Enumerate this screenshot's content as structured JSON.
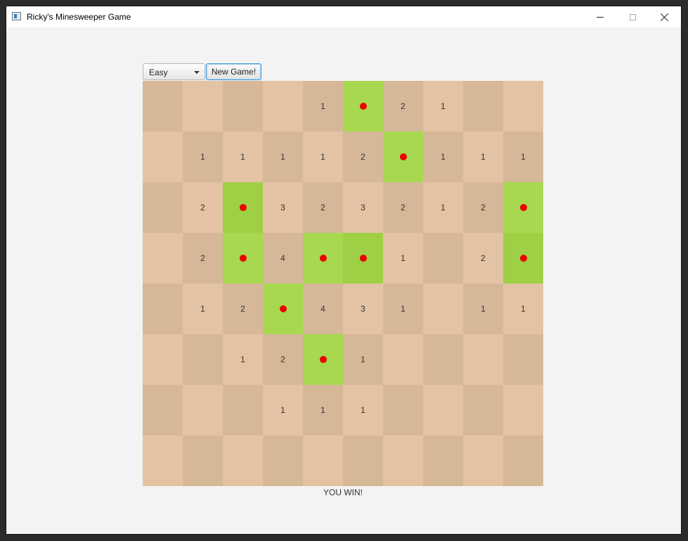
{
  "window": {
    "title": "Ricky's Minesweeper Game"
  },
  "toolbar": {
    "difficulty_selected": "Easy",
    "new_game_label": "New Game!"
  },
  "board": {
    "rows": 8,
    "cols": 10,
    "cells": [
      [
        "",
        "",
        "",
        "",
        "1",
        "*",
        "2",
        "1",
        "",
        ""
      ],
      [
        "",
        "1",
        "1",
        "1",
        "1",
        "2",
        "*",
        "1",
        "1",
        "1"
      ],
      [
        "",
        "2",
        "*",
        "3",
        "2",
        "3",
        "2",
        "1",
        "2",
        "*"
      ],
      [
        "",
        "2",
        "*",
        "4",
        "*",
        "*",
        "1",
        "",
        "2",
        "*"
      ],
      [
        "",
        "1",
        "2",
        "*",
        "4",
        "3",
        "1",
        "",
        "1",
        "1"
      ],
      [
        "",
        "",
        "1",
        "2",
        "*",
        "1",
        "",
        "",
        "",
        ""
      ],
      [
        "",
        "",
        "",
        "1",
        "1",
        "1",
        "",
        "",
        "",
        ""
      ],
      [
        "",
        "",
        "",
        "",
        "",
        "",
        "",
        "",
        "",
        ""
      ]
    ],
    "colors": {
      "light": "#e3c3a3",
      "dark": "#d6b899",
      "mine_light": "#a7d84f",
      "mine_dark": "#9fcf45",
      "mine_dot": "#ee0000"
    }
  },
  "status": {
    "text": "YOU WIN!"
  }
}
